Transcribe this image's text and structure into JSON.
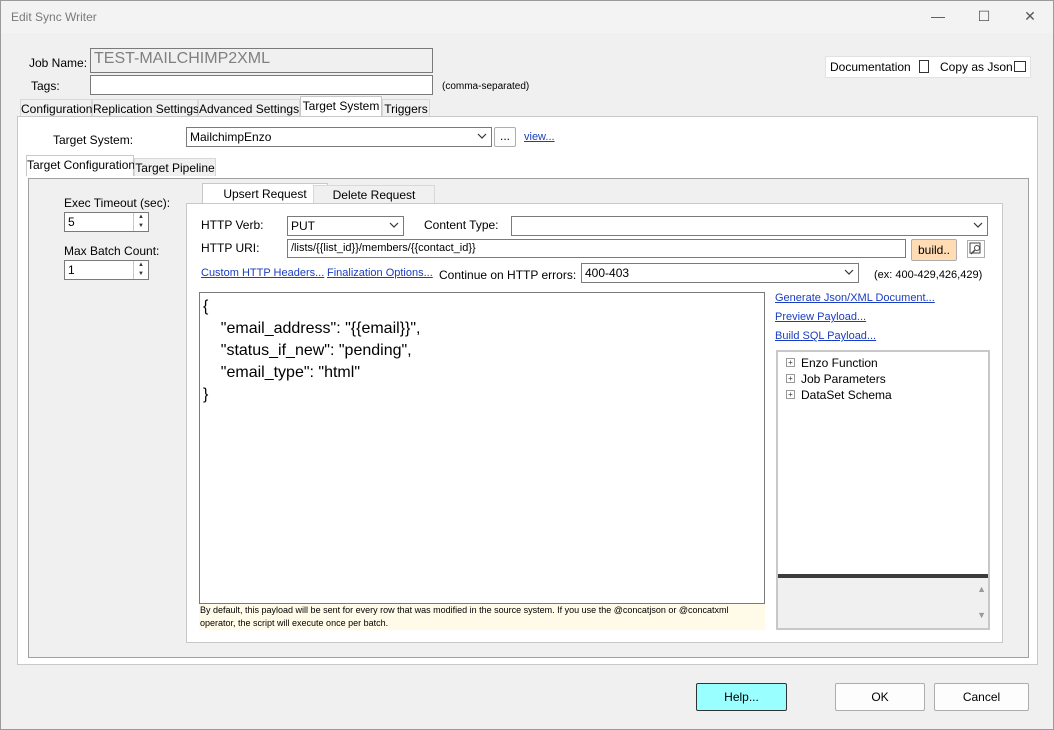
{
  "window": {
    "title": "Edit Sync Writer"
  },
  "job": {
    "name_label": "Job Name:",
    "name_value": "TEST-MAILCHIMP2XML",
    "tags_label": "Tags:",
    "tags_value": "",
    "tags_hint": "(comma-separated)"
  },
  "top_buttons": {
    "documentation": "Documentation",
    "copy_json": "Copy as Json"
  },
  "main_tabs": [
    "Configuration",
    "Replication Settings",
    "Advanced Settings",
    "Target System",
    "Triggers"
  ],
  "target": {
    "label": "Target System:",
    "value": "MailchimpEnzo",
    "ellipsis": "...",
    "view_link": "view..."
  },
  "sub_tabs": [
    "Target Configuration",
    "Target Pipeline"
  ],
  "left": {
    "exec_timeout_label": "Exec Timeout (sec):",
    "exec_timeout_value": "5",
    "max_batch_label": "Max Batch Count:",
    "max_batch_value": "1"
  },
  "request_tabs": [
    "Upsert Request",
    "Delete Request"
  ],
  "request": {
    "verb_label": "HTTP Verb:",
    "verb_value": "PUT",
    "content_type_label": "Content Type:",
    "content_type_value": "",
    "uri_label": "HTTP URI:",
    "uri_value": "/lists/{{list_id}}/members/{{contact_id}}",
    "build_label": "build..",
    "custom_headers_link": "Custom HTTP Headers...",
    "finalization_link": "Finalization Options...",
    "continue_label": "Continue on HTTP errors:",
    "continue_value": "400-403",
    "continue_hint": "(ex: 400-429,426,429)"
  },
  "payload": {
    "line1": "{",
    "line2": "    \"email_address\": \"{{email}}\",",
    "line3": "    \"status_if_new\": \"pending\",",
    "line4": "    \"email_type\": \"html\"",
    "line5": "}",
    "note": "By default, this payload will be sent for every row that was modified in the source system.  If you use the @concatjson or @concatxml operator, the script will execute once per batch."
  },
  "side_links": {
    "generate": "Generate Json/XML Document...",
    "preview": "Preview Payload...",
    "build_sql": "Build SQL Payload..."
  },
  "tree": [
    "Enzo Function",
    "Job Parameters",
    "DataSet Schema"
  ],
  "footer": {
    "help": "Help...",
    "ok": "OK",
    "cancel": "Cancel"
  },
  "colors": {
    "help_bg": "#99ffff",
    "build_bg": "#ffdcb4",
    "link": "#1a3dc1"
  }
}
